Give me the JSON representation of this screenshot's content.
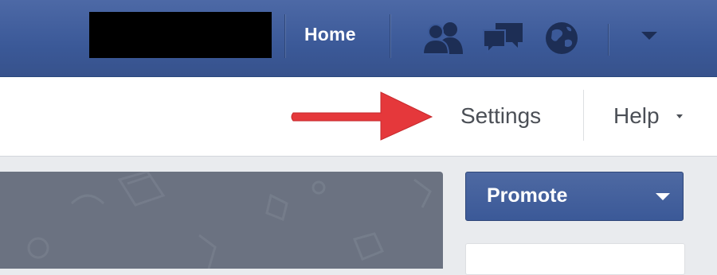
{
  "topbar": {
    "home_label": "Home",
    "icons": [
      "friend-requests-icon",
      "messages-icon",
      "notifications-globe-icon",
      "account-menu-caret-icon"
    ],
    "background": "#3b5998"
  },
  "subheader": {
    "settings_label": "Settings",
    "help_label": "Help"
  },
  "sidebar": {
    "promote_label": "Promote"
  },
  "annotation": {
    "arrow_color": "#e5383b"
  }
}
